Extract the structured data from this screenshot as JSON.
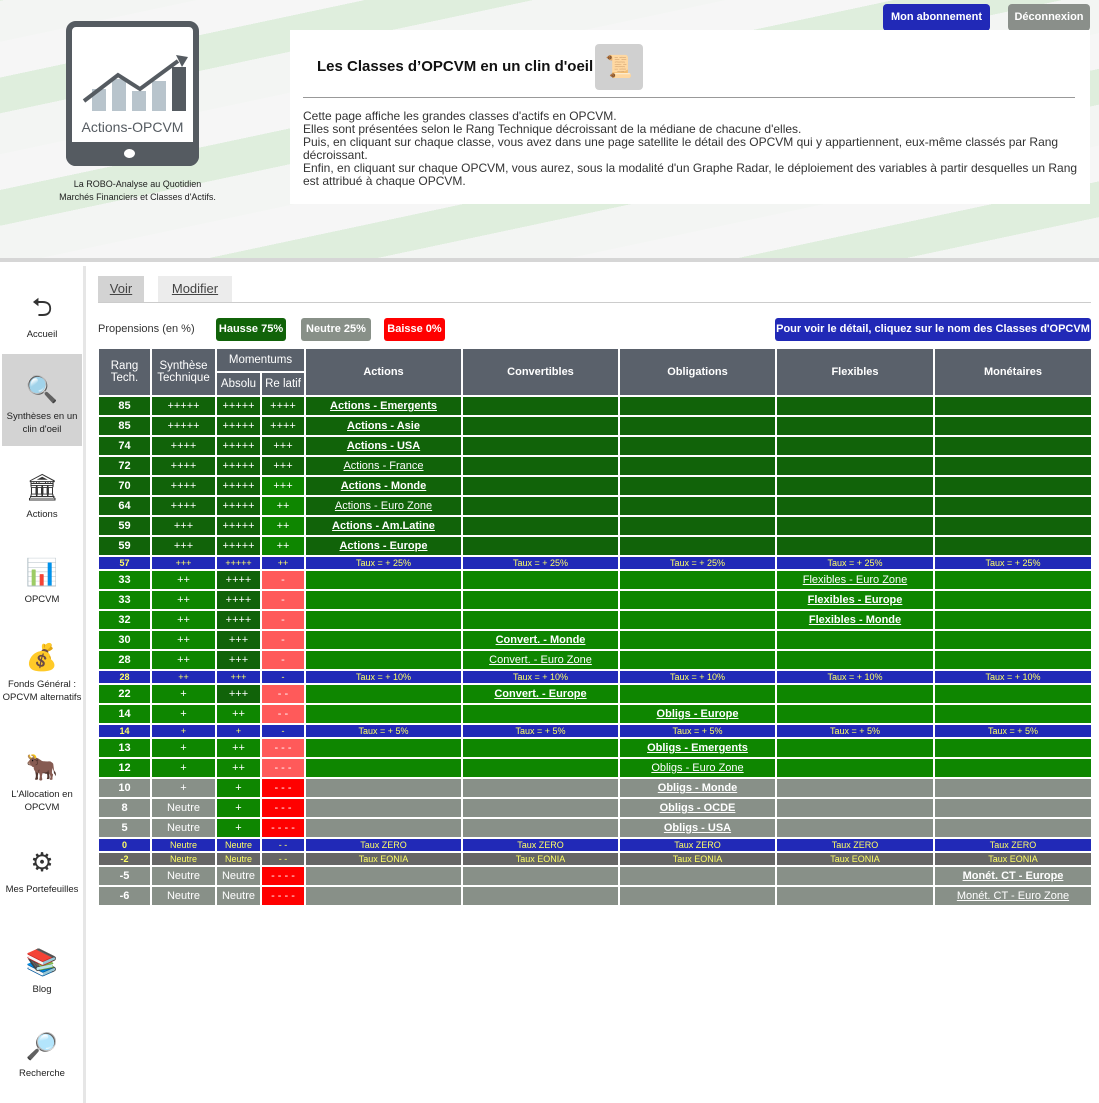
{
  "header": {
    "logo_text": "Actions-OPCVM",
    "tagline_1": "La ROBO-Analyse au Quotidien",
    "tagline_2": "Marchés Financiers et Classes d'Actifs.",
    "subscription_button": "Mon abonnement",
    "logout_button": "Déconnexion",
    "title": "Les Classes d’OPCVM en un clin d'oeil",
    "doc_icon": "scroll-icon",
    "description": [
      "Cette page affiche les  grandes classes d'actifs en OPCVM.",
      "Elles sont présentées selon le Rang Technique décroissant de la médiane de chacune d'elles.",
      "Puis, en cliquant sur chaque classe, vous avez dans une page satellite  le détail des OPCVM qui y appartiennent, eux-même classés par Rang décroissant.",
      "Enfin, en cliquant sur chaque OPCVM, vous aurez, sous la modalité d'un Graphe Radar, le déploiement des variables à partir desquelles un Rang est attribué à chaque OPCVM."
    ]
  },
  "sidebar": {
    "items": [
      {
        "label": "Accueil",
        "icon": "home-back-icon"
      },
      {
        "label": "Synthèses en un clin d'oeil",
        "icon": "magnifier-chart-icon",
        "active": true
      },
      {
        "label": "Actions",
        "icon": "bank-icon"
      },
      {
        "label": "OPCVM",
        "icon": "bar-chart-icon"
      },
      {
        "label": "Fonds Général : OPCVM alternatifs",
        "icon": "money-bag-icon"
      },
      {
        "label": "L'Allocation en OPCVM",
        "icon": "bull-icon"
      },
      {
        "label": "Mes Portefeuilles",
        "icon": "gears-icon"
      },
      {
        "label": "Blog",
        "icon": "books-icon"
      },
      {
        "label": "Recherche",
        "icon": "search-icon"
      }
    ]
  },
  "tabs": {
    "voir": "Voir",
    "modifier": "Modifier"
  },
  "propensions": {
    "label": "Propensions (en %)",
    "hausse": "Hausse 75%",
    "neutre": "Neutre 25%",
    "baisse": "Baisse 0%",
    "detail_button": "Pour voir le détail, cliquez sur le nom des Classes d'OPCVM"
  },
  "colors": {
    "dark_green": "#116309",
    "green": "#0e8600",
    "light_red": "#ff5a5a",
    "red": "#ff0000",
    "gray": "#889088",
    "blue": "#2129b7",
    "dark_gray": "#666666",
    "header": "#5a616b"
  },
  "table": {
    "headers": {
      "rang": "Rang Tech.",
      "synthese": "Synthèse Technique",
      "momentums": "Momentums",
      "absolu": "Absolu",
      "relatif": "Re latif",
      "classes": [
        "Actions",
        "Convertibles",
        "Obligations",
        "Flexibles",
        "Monétaires"
      ]
    },
    "rows": [
      {
        "rank": "85",
        "synth": "+++++",
        "abs": "+++++",
        "rel": "++++",
        "row": "D",
        "absc": "D",
        "relc": "D",
        "col": 0,
        "label": "Actions - Emergents",
        "bold": true
      },
      {
        "rank": "85",
        "synth": "+++++",
        "abs": "+++++",
        "rel": "++++",
        "row": "D",
        "absc": "D",
        "relc": "D",
        "col": 0,
        "label": "Actions - Asie",
        "bold": true
      },
      {
        "rank": "74",
        "synth": "++++",
        "abs": "+++++",
        "rel": "+++",
        "row": "D",
        "absc": "D",
        "relc": "D",
        "col": 0,
        "label": "Actions - USA",
        "bold": true
      },
      {
        "rank": "72",
        "synth": "++++",
        "abs": "+++++",
        "rel": "+++",
        "row": "D",
        "absc": "D",
        "relc": "D",
        "col": 0,
        "label": "Actions - France",
        "bold": false
      },
      {
        "rank": "70",
        "synth": "++++",
        "abs": "+++++",
        "rel": "+++",
        "row": "D",
        "absc": "D",
        "relc": "G",
        "col": 0,
        "label": "Actions - Monde",
        "bold": true
      },
      {
        "rank": "64",
        "synth": "++++",
        "abs": "+++++",
        "rel": "++",
        "row": "D",
        "absc": "D",
        "relc": "G",
        "col": 0,
        "label": "Actions - Euro Zone",
        "bold": false
      },
      {
        "rank": "59",
        "synth": "+++",
        "abs": "+++++",
        "rel": "++",
        "row": "D",
        "absc": "D",
        "relc": "G",
        "col": 0,
        "label": "Actions - Am.Latine",
        "bold": true
      },
      {
        "rank": "59",
        "synth": "+++",
        "abs": "+++++",
        "rel": "++",
        "row": "D",
        "absc": "D",
        "relc": "G",
        "col": 0,
        "label": "Actions - Europe",
        "bold": true
      },
      {
        "sep": true,
        "rank": "57",
        "synth": "+++",
        "abs": "+++++",
        "rel": "++",
        "row": "B",
        "taux": "Taux = + 25%"
      },
      {
        "rank": "33",
        "synth": "++",
        "abs": "++++",
        "rel": "-",
        "row": "G",
        "absc": "D",
        "relc": "LR",
        "col": 3,
        "label": "Flexibles - Euro Zone",
        "bold": false
      },
      {
        "rank": "33",
        "synth": "++",
        "abs": "++++",
        "rel": "-",
        "row": "G",
        "absc": "D",
        "relc": "LR",
        "col": 3,
        "label": "Flexibles - Europe",
        "bold": true
      },
      {
        "rank": "32",
        "synth": "++",
        "abs": "++++",
        "rel": "-",
        "row": "G",
        "absc": "D",
        "relc": "LR",
        "col": 3,
        "label": "Flexibles - Monde",
        "bold": true
      },
      {
        "rank": "30",
        "synth": "++",
        "abs": "+++",
        "rel": "-",
        "row": "G",
        "absc": "D",
        "relc": "LR",
        "col": 1,
        "label": "Convert. - Monde",
        "bold": true
      },
      {
        "rank": "28",
        "synth": "++",
        "abs": "+++",
        "rel": "-",
        "row": "G",
        "absc": "D",
        "relc": "LR",
        "col": 1,
        "label": "Convert. - Euro Zone",
        "bold": false
      },
      {
        "sep": true,
        "rank": "28",
        "synth": "++",
        "abs": "+++",
        "rel": "-",
        "row": "B",
        "taux": "Taux = + 10%"
      },
      {
        "rank": "22",
        "synth": "+",
        "abs": "+++",
        "rel": "- -",
        "row": "G",
        "absc": "D",
        "relc": "LR",
        "col": 1,
        "label": "Convert. - Europe",
        "bold": true
      },
      {
        "rank": "14",
        "synth": "+",
        "abs": "++",
        "rel": "- -",
        "row": "G",
        "absc": "G",
        "relc": "LR",
        "col": 2,
        "label": "Obligs - Europe",
        "bold": true
      },
      {
        "sep": true,
        "rank": "14",
        "synth": "+",
        "abs": "+",
        "rel": "-",
        "row": "B",
        "taux": "Taux = + 5%"
      },
      {
        "rank": "13",
        "synth": "+",
        "abs": "++",
        "rel": "- - -",
        "row": "G",
        "absc": "G",
        "relc": "LR",
        "col": 2,
        "label": "Obligs - Emergents",
        "bold": true
      },
      {
        "rank": "12",
        "synth": "+",
        "abs": "++",
        "rel": "- - -",
        "row": "G",
        "absc": "G",
        "relc": "LR",
        "col": 2,
        "label": "Obligs - Euro Zone",
        "bold": false
      },
      {
        "rank": "10",
        "synth": "+",
        "abs": "+",
        "rel": "- - -",
        "row": "GR",
        "absc": "G",
        "relc": "R",
        "col": 2,
        "label": "Obligs - Monde",
        "bold": true
      },
      {
        "rank": "8",
        "synth": "Neutre",
        "abs": "+",
        "rel": "- - -",
        "row": "GR",
        "absc": "G",
        "relc": "R",
        "col": 2,
        "label": "Obligs - OCDE",
        "bold": true
      },
      {
        "rank": "5",
        "synth": "Neutre",
        "abs": "+",
        "rel": "- - - -",
        "row": "GR",
        "absc": "G",
        "relc": "R",
        "col": 2,
        "label": "Obligs - USA",
        "bold": true
      },
      {
        "sep": true,
        "rank": "0",
        "synth": "Neutre",
        "abs": "Neutre",
        "rel": "- -",
        "row": "B",
        "taux": "Taux ZERO"
      },
      {
        "sep": true,
        "rank": "-2",
        "synth": "Neutre",
        "abs": "Neutre",
        "rel": "- -",
        "row": "DG",
        "taux": "Taux EONIA"
      },
      {
        "rank": "-5",
        "synth": "Neutre",
        "abs": "Neutre",
        "rel": "- - - -",
        "row": "GR",
        "absc": "GR",
        "relc": "R",
        "col": 4,
        "label": "Monét. CT - Europe",
        "bold": true
      },
      {
        "rank": "-6",
        "synth": "Neutre",
        "abs": "Neutre",
        "rel": "- - - -",
        "row": "GR",
        "absc": "GR",
        "relc": "R",
        "col": 4,
        "label": "Monét. CT - Euro Zone",
        "bold": false
      }
    ]
  }
}
